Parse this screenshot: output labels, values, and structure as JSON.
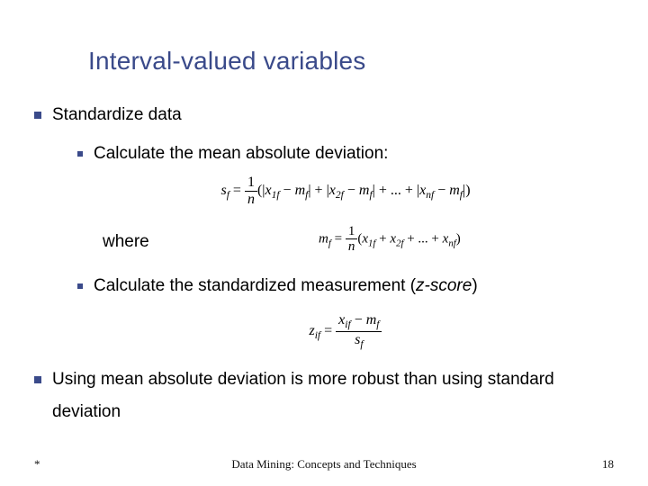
{
  "title": "Interval-valued variables",
  "items": [
    {
      "text": "Standardize data"
    },
    {
      "text": "Using mean absolute deviation is more robust than using standard deviation"
    }
  ],
  "sub_items": [
    {
      "text": "Calculate the mean absolute deviation:"
    },
    {
      "text_prefix": "Calculate the standardized measurement (",
      "text_italic": "z-score",
      "text_suffix": ")"
    }
  ],
  "where_label": "where",
  "formulas": {
    "mad": "s_f = (1/n)(|x_{1f} − m_f| + |x_{2f} − m_f| + ... + |x_{nf} − m_f|)",
    "mean": "m_f = (1/n)(x_{1f} + x_{2f} + ... + x_{nf})",
    "zscore": "z_{if} = (x_{if} − m_f) / s_f"
  },
  "footer": {
    "left": "*",
    "center": "Data Mining: Concepts and Techniques",
    "page": "18"
  }
}
